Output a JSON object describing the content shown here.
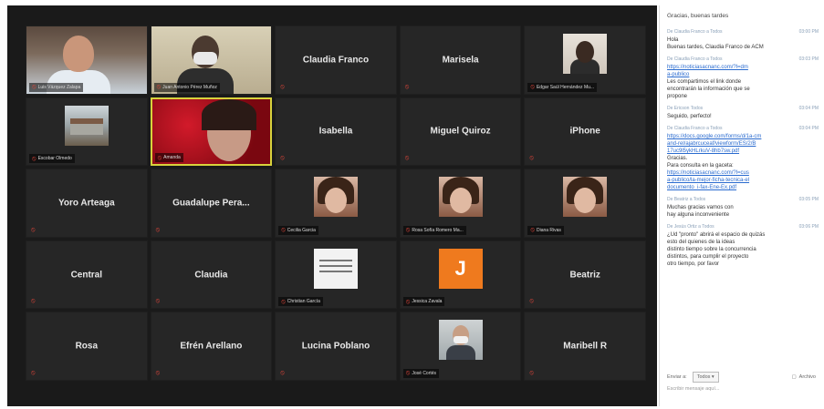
{
  "grid": [
    {
      "type": "video",
      "kind": "man1",
      "label": "Luis Vázquez Zalapa"
    },
    {
      "type": "video",
      "kind": "man2",
      "label": "Juan Antonio Pérez Muñoz"
    },
    {
      "type": "name",
      "name": "Claudia Franco"
    },
    {
      "type": "name",
      "name": "Marisela"
    },
    {
      "type": "photo",
      "kind": "woman1",
      "label": "Edgar Saúl Hernández Mu..."
    },
    {
      "type": "photo",
      "kind": "building",
      "label": "Escobar Olmedo"
    },
    {
      "type": "video",
      "kind": "red",
      "label": "Amanda",
      "active": true
    },
    {
      "type": "name",
      "name": "Isabella"
    },
    {
      "type": "name",
      "name": "Miguel Quiroz"
    },
    {
      "type": "name",
      "name": "iPhone"
    },
    {
      "type": "name",
      "name": "Yoro Arteaga"
    },
    {
      "type": "name",
      "name": "Guadalupe Pera..."
    },
    {
      "type": "photo",
      "kind": "face",
      "label": "Cecilia Garcia"
    },
    {
      "type": "photo",
      "kind": "face",
      "label": "Rosa Sofía Romero Ma..."
    },
    {
      "type": "photo",
      "kind": "face",
      "label": "Diana Rivas"
    },
    {
      "type": "name",
      "name": "Central"
    },
    {
      "type": "name",
      "name": "Claudia"
    },
    {
      "type": "photo",
      "kind": "text",
      "label": "Christian García"
    },
    {
      "type": "photo",
      "kind": "j",
      "letter": "J",
      "label": "Jessica Zavala"
    },
    {
      "type": "name",
      "name": "Beatriz"
    },
    {
      "type": "name",
      "name": "Rosa"
    },
    {
      "type": "name",
      "name": "Efrén Arellano"
    },
    {
      "type": "name",
      "name": "Lucina Poblano"
    },
    {
      "type": "photo",
      "kind": "man",
      "label": "José Cortés"
    },
    {
      "type": "name",
      "name": "Maribell R"
    }
  ],
  "chat": {
    "header": "Gracias, buenas tardes",
    "messages": [
      {
        "from": "De Claudia Franco a Todos",
        "time": "03:00 PM",
        "lines": [
          "Hola",
          "Buenas tardes, Claudia Franco de ACM"
        ]
      },
      {
        "from": "De Claudia Franco a Todos",
        "time": "03:03 PM",
        "lines": [
          "https://noticiasacnanc.com/?l=dm",
          "a-publico",
          "Les compartimos el link donde",
          "encontrarán la información que se",
          "propone"
        ],
        "links": [
          0,
          1
        ]
      },
      {
        "from": "De Ericson Todos",
        "time": "03:04 PM",
        "lines": [
          "Seguido, perfecto!"
        ]
      },
      {
        "from": "De Claudia Franco a Todos",
        "time": "03:04 PM",
        "lines": [
          "https://docs.google.com/forms/d/1a-cm",
          "and-rel/ajabrcuceaf/viewform/ES/2/B",
          "17uc9l5ykHLrkuV-8hb7sw.pdf",
          "Gracias.",
          "Para consulta en la gaceta:",
          "https://noticiasacnanc.com/?l=cus",
          "a-publico/la-mejor-ficha-tecnica-el",
          "documento_i-fax-Ene-Ex.pdf"
        ],
        "links": [
          0,
          1,
          2,
          5,
          6,
          7
        ]
      },
      {
        "from": "De Beatriz a Todos",
        "time": "03:05 PM",
        "lines": [
          "Muchas gracias vamos con",
          "hay alguna inconveniente"
        ]
      },
      {
        "from": "De Jesús Ortiz a Todos",
        "time": "03:06 PM",
        "lines": [
          "¿Ud \"pronto\" abrirá el espacio de quizás",
          "esto del quienes de la ideas",
          "distinto tiempo sobre la concurrencia",
          "distintos, para cumplir el proyecto",
          "otro tiempo, por favor"
        ]
      }
    ],
    "to_label": "Enviar a:",
    "to_value": "Todos",
    "file_label": "Archivo",
    "input_placeholder": "Escribir mensaje aquí..."
  }
}
